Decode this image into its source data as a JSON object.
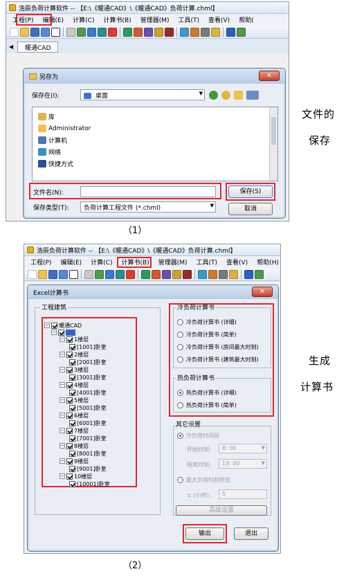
{
  "side_labels": {
    "top": [
      "文件的",
      "保存"
    ],
    "bottom": [
      "生成",
      "计算书"
    ]
  },
  "captions": {
    "fig1": "（1）",
    "fig2": "（2）"
  },
  "screenshot1": {
    "window_title": "浩辰负荷计算软件 -- 【E:\\《暖通CAD》\\《暖通CAD》负荷计算.chml】",
    "menu": [
      "工程(P)",
      "编辑(E)",
      "计算(C)",
      "计算书(B)",
      "管理器(M)",
      "工具(T)",
      "查看(V)",
      "帮助("
    ],
    "doc_tab": "暖通CAD",
    "save_dialog": {
      "title": "另存为",
      "close": "✕",
      "save_in_label": "保存在(I):",
      "save_in_value": "桌面",
      "items": [
        "库",
        "Administrator",
        "计算机",
        "网络",
        "快捷方式"
      ],
      "filename_label": "文件名(N):",
      "filename_value": "",
      "filetype_label": "保存类型(T):",
      "filetype_value": "负荷计算工程文件 (*.chml)",
      "save_button": "保存(S)",
      "cancel_button": "取消"
    }
  },
  "screenshot2": {
    "window_title": "浩辰负荷计算软件 -- 【E:\\《暖通CAD》\\《暖通CAD》负荷计算.chml】",
    "menu": [
      "工程(P)",
      "编辑(E)",
      "计算(C)",
      "计算书(B)",
      "管理器(M)",
      "工具(T)",
      "查看(V)",
      "帮助(H)"
    ],
    "excel_dialog": {
      "title": "Excel计算书",
      "close": "✕",
      "tree_group_label": "工程建筑",
      "tree_root": "暖通CAD",
      "floors": [
        {
          "floor": "1楼层",
          "room": "[1001]卧室"
        },
        {
          "floor": "2楼层",
          "room": "[2001]卧室"
        },
        {
          "floor": "3楼层",
          "room": "[3001]卧室"
        },
        {
          "floor": "4楼层",
          "room": "[4001]卧室"
        },
        {
          "floor": "5楼层",
          "room": "[5001]卧室"
        },
        {
          "floor": "6楼层",
          "room": "[6001]卧室"
        },
        {
          "floor": "7楼层",
          "room": "[7001]卧室"
        },
        {
          "floor": "8楼层",
          "room": "[8001]卧室"
        },
        {
          "floor": "9楼层",
          "room": "[9001]卧室"
        },
        {
          "floor": "10楼层",
          "room": "[10001]卧室"
        }
      ],
      "cooling_label": "冷负荷计算书",
      "cooling_options": [
        "冷负荷计算书 (详细)",
        "冷负荷计算书 (简单)",
        "冷负荷计算书 (房间最大时刻)",
        "冷负荷计算书 (建筑最大时刻)"
      ],
      "heating_label": "热负荷计算书",
      "heating_options": [
        "热负荷计算书 (详细)",
        "热负荷计算书 (简单)"
      ],
      "heating_selected": 0,
      "other_label": "其它设置",
      "cooling_period_label": "冷负荷时间段",
      "start_label": "开始时刻:",
      "start_value": "8: 00",
      "end_label": "结束时刻:",
      "end_value": "19: 00",
      "max_time_label": "最大负荷时刻附近",
      "hours_label": "± (小时):",
      "hours_value": "5",
      "advanced_button": "高级设置",
      "output_button": "输出",
      "exit_button": "退出"
    }
  },
  "colors": {
    "highlight_frame": "#e8232a"
  }
}
